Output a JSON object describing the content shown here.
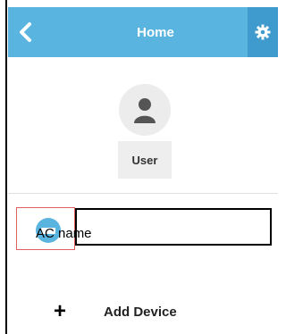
{
  "header": {
    "title": "Home",
    "back_icon": "chevron-left-icon",
    "settings_icon": "gear-icon",
    "accent_color": "#5ab4e0",
    "settings_color": "#3f9acd"
  },
  "profile": {
    "avatar_icon": "user-silhouette-icon",
    "label": "User"
  },
  "devices": [
    {
      "name": "AC name",
      "icon": "air-conditioner-icon"
    }
  ],
  "add_device": {
    "icon": "plus-icon",
    "label": "Add Device"
  }
}
